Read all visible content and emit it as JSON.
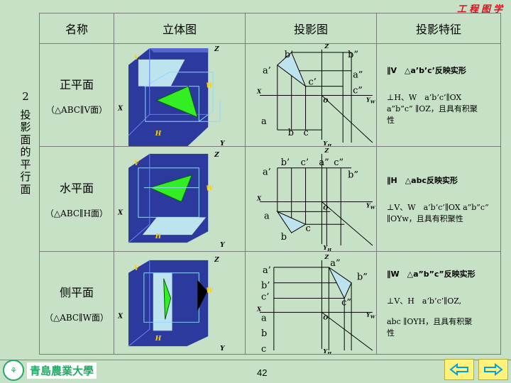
{
  "corner_title": "工程图学",
  "section": {
    "number": "2",
    "title_chars": [
      "投",
      "影",
      "面",
      "的",
      "平",
      "行",
      "面"
    ]
  },
  "headers": {
    "name": "名称",
    "solid": "立体图",
    "projection": "投影图",
    "feature": "投影特征"
  },
  "rows": [
    {
      "name": "正平面",
      "sub": "（△ABC∥V面）",
      "f1": "∥V　△a’b’c’反映实形",
      "f2": "⊥H、W　a’b’c’∥OX",
      "f3": "a”b”c” ∥OZ，且具有积聚",
      "f4": "性",
      "cube": {
        "V": "V",
        "W": "W",
        "H": "H",
        "X": "X",
        "Y": "Y",
        "Z": "Z"
      },
      "proj": {
        "Z": "Z",
        "X": "X",
        "O": "O",
        "YW": "Y",
        "YWs": "W",
        "YH": "Y",
        "YHs": "H",
        "bp": "b’",
        "bpp": "b”",
        "ap": "a’",
        "cp": "c’",
        "app": "a”",
        "cpp": "c”",
        "a": "a",
        "b": "b",
        "c": "c"
      }
    },
    {
      "name": "水平面",
      "sub": "（△ABC∥H面）",
      "f1": "∥H　△abc反映实形",
      "f2": "⊥V、W　a’b’c’∥OX a”b”c”",
      "f3": "∥OYw，且具有积聚性",
      "f4": "",
      "cube": {
        "V": "V",
        "W": "W",
        "H": "H",
        "X": "X",
        "Y": "Y",
        "Z": "Z"
      },
      "proj": {
        "Z": "Z",
        "X": "X",
        "O": "O",
        "YW": "Y",
        "YWs": "W",
        "YH": "Y",
        "YHs": "H",
        "ap": "a’",
        "bp": "b’",
        "cp": "c’",
        "app": "a”",
        "cpp": "c”",
        "bpp": "b”",
        "a": "a",
        "b": "b",
        "c": "c"
      }
    },
    {
      "name": "侧平面",
      "sub": "（△ABC∥W面）",
      "f1": "∥W　△a”b”c”反映实形",
      "f2": "⊥V、H　a’b’c’∥OZ,",
      "f3": "abc ∥OYH，且具有积聚",
      "f4": "性",
      "cube": {
        "V": "V",
        "W": "W",
        "H": "H",
        "X": "X",
        "Y": "Y",
        "Z": "Z"
      },
      "proj": {
        "Z": "Z",
        "X": "X",
        "O": "O",
        "YW": "Y",
        "YWs": "W",
        "YH": "Y",
        "YHs": "H",
        "ap": "a’",
        "bp": "b’",
        "cp": "c’",
        "app": "a”",
        "bpp": "b”",
        "cpp": "c”",
        "a": "a",
        "b": "b",
        "c": "c"
      }
    }
  ],
  "logo_text": "青島農業大學",
  "page_number": "42",
  "nav": {
    "prev": "prev-arrow-icon",
    "next": "next-arrow-icon"
  },
  "colors": {
    "background": "#c7e1c7",
    "cube_blue": "#2b3a9c",
    "plane_green": "#33ee22",
    "plane_lightblue": "#bde3ef",
    "corner_red": "#d2141e"
  }
}
